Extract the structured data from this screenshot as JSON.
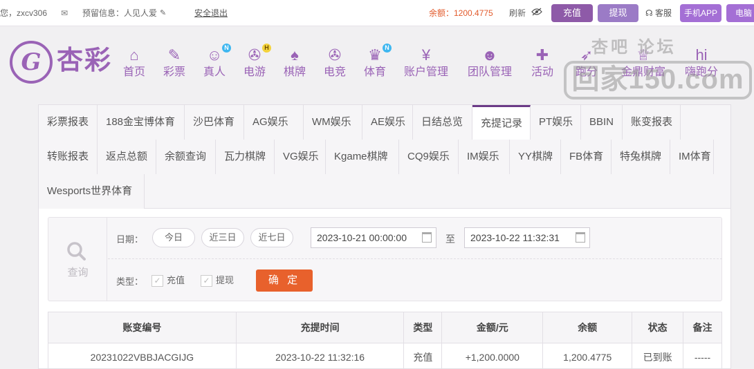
{
  "topbar": {
    "user_text": "您，zxcv306",
    "info_text": "预留信息：人见人爱",
    "logout": "安全退出",
    "balance": "余额：1200.4775",
    "refresh": "刷新",
    "deposit": "充值",
    "withdraw": "提现",
    "service": "客服",
    "app": "手机APP",
    "pc": "电脑"
  },
  "logo": {
    "text": "杏彩",
    "mark": "G"
  },
  "nav": [
    {
      "label": "首页",
      "icon": "home-icon",
      "glyph": "⌂"
    },
    {
      "label": "彩票",
      "icon": "lottery-icon",
      "glyph": "✎"
    },
    {
      "label": "真人",
      "icon": "live-dealer-icon",
      "glyph": "☺",
      "badge": "N"
    },
    {
      "label": "电游",
      "icon": "gamepad-icon",
      "glyph": "✇",
      "badge": "H"
    },
    {
      "label": "棋牌",
      "icon": "cards-icon",
      "glyph": "♠"
    },
    {
      "label": "电竞",
      "icon": "esports-icon",
      "glyph": "✇"
    },
    {
      "label": "体育",
      "icon": "trophy-icon",
      "glyph": "♛",
      "badge": "N"
    },
    {
      "label": "账户管理",
      "icon": "yen-coin-icon",
      "glyph": "¥"
    },
    {
      "label": "团队管理",
      "icon": "team-icon",
      "glyph": "☻"
    },
    {
      "label": "活动",
      "icon": "gift-icon",
      "glyph": "✚"
    },
    {
      "label": "跑分",
      "icon": "run-icon",
      "glyph": "➶"
    },
    {
      "label": "金鼎财富",
      "icon": "wealth-icon",
      "glyph": "♕"
    },
    {
      "label": "嗨跑分",
      "icon": "hi-icon",
      "glyph": "hi"
    }
  ],
  "watermark": {
    "line1": "杏吧 论坛",
    "line2": "回家150.com"
  },
  "tabs": [
    "彩票报表",
    "188金宝博体育",
    "沙巴体育",
    "AG娱乐",
    "WM娱乐",
    "AE娱乐",
    "日结总览",
    "充提记录",
    "PT娱乐",
    "BBIN",
    "账变报表",
    "转账报表",
    "返点总额",
    "余额查询",
    "瓦力棋牌",
    "VG娱乐",
    "Kgame棋牌",
    "CQ9娱乐",
    "IM娱乐",
    "YY棋牌",
    "FB体育",
    "特兔棋牌",
    "IM体育",
    "Wesports世界体育"
  ],
  "active_tab": "充提记录",
  "query": {
    "label": "查询",
    "date_caption": "日期：",
    "quick": [
      "今日",
      "近三日",
      "近七日"
    ],
    "start": "2023-10-21 00:00:00",
    "to": "至",
    "end": "2023-10-22 11:32:31",
    "type_caption": "类型：",
    "types": [
      "充值",
      "提现"
    ],
    "confirm": "确 定"
  },
  "table": {
    "headers": [
      "账变编号",
      "充提时间",
      "类型",
      "金额/元",
      "余额",
      "状态",
      "备注"
    ],
    "rows": [
      [
        "20231022VBBJACGIJG",
        "2023-10-22 11:32:16",
        "充值",
        "+1,200.0000",
        "1,200.4775",
        "已到账",
        "-----"
      ]
    ]
  },
  "colors": {
    "brand": "#9a63b6",
    "accent": "#e8612c",
    "amount": "#dd3333",
    "success": "#22a03a"
  }
}
